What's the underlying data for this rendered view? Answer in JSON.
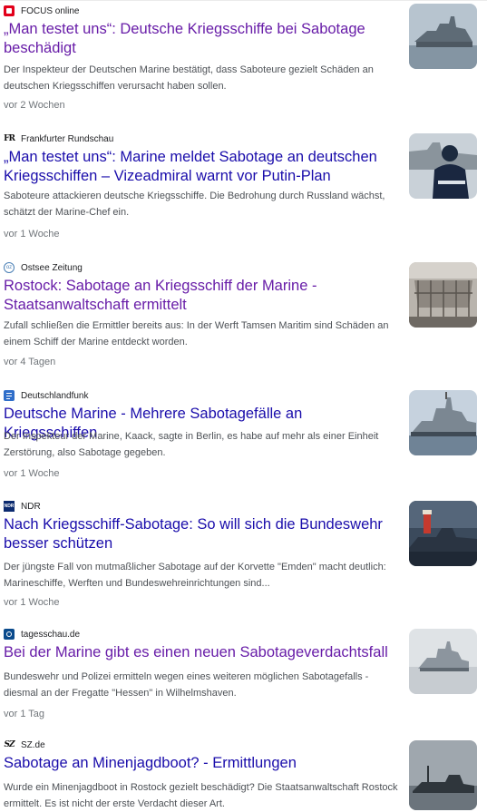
{
  "articles": [
    {
      "source": "FOCUS online",
      "favicon": "focus-online-favicon",
      "headline": "„Man testet uns“: Deutsche Kriegsschiffe bei Sabotage beschädigt",
      "snippet": "Der Inspekteur der Deutschen Marine bestätigt, dass Saboteure gezielt Schäden an deutschen Kriegsschiffen verursacht haben sollen.",
      "age": "vor 2 Wochen",
      "visited": true,
      "thumbnail": "warship-thumbnail"
    },
    {
      "source": "Frankfurter Rundschau",
      "favicon": "frankfurter-rundschau-favicon",
      "headline": "„Man testet uns“: Marine meldet Sabotage an deutschen Kriegsschiffen – Vizeadmiral warnt vor Putin-Plan",
      "snippet": "Saboteure attackieren deutsche Kriegsschiffe. Die Bedrohung durch Russland wächst, schätzt der Marine-Chef ein.",
      "age": "vor 1 Woche",
      "visited": false,
      "thumbnail": "sailor-thumbnail"
    },
    {
      "source": "Ostsee Zeitung",
      "favicon": "ostsee-zeitung-favicon",
      "headline": "Rostock: Sabotage an Kriegsschiff der Marine - Staatsanwaltschaft ermittelt",
      "snippet": "Zufall schließen die Ermittler bereits aus: In der Werft Tamsen Maritim sind Schäden an einem Schiff der Marine entdeckt worden.",
      "age": "vor 4 Tagen",
      "visited": true,
      "thumbnail": "shipyard-thumbnail"
    },
    {
      "source": "Deutschlandfunk",
      "favicon": "deutschlandfunk-favicon",
      "headline": "Deutsche Marine - Mehrere Sabotagefälle an Kriegsschiffen",
      "snippet": "Der Inspekteur der Marine, Kaack, sagte in Berlin, es habe auf mehr als einer Einheit Zerstörung, also Sabotage gegeben.",
      "age": "vor 1 Woche",
      "visited": false,
      "thumbnail": "frigate-harbor-thumbnail"
    },
    {
      "source": "NDR",
      "favicon": "ndr-favicon",
      "headline": "Nach Kriegsschiff-Sabotage: So will sich die Bundeswehr besser schützen",
      "snippet": "Der jüngste Fall von mutmaßlicher Sabotage auf der Korvette \"Emden\" macht deutlich: Marineschiffe, Werften und Bundeswehreinrichtungen sind...",
      "age": "vor 1 Woche",
      "visited": false,
      "thumbnail": "corvette-lighthouse-thumbnail"
    },
    {
      "source": "tagesschau.de",
      "favicon": "tagesschau-favicon",
      "headline": "Bei der Marine gibt es einen neuen Sabotageverdachtsfall",
      "snippet": "Bundeswehr und Polizei ermitteln wegen eines weiteren möglichen Sabotagefalls - diesmal an der Fregatte \"Hessen\" in Wilhelmshaven.",
      "age": "vor 1 Tag",
      "visited": true,
      "thumbnail": "frigate-hessen-thumbnail"
    },
    {
      "source": "SZ.de",
      "favicon": "sz-favicon",
      "headline": "Sabotage an Minenjagdboot? - Ermittlungen",
      "snippet": "Wurde ein Minenjagdboot in Rostock gezielt beschädigt? Die Staatsanwaltschaft Rostock ermittelt. Es ist nicht der erste Verdacht dieser Art.",
      "age": "",
      "visited": false,
      "thumbnail": "minehunter-thumbnail"
    }
  ],
  "colors": {
    "link": "#1a0dab",
    "visited_link": "#681da8",
    "snippet": "#4d5156",
    "meta": "#70757a"
  }
}
